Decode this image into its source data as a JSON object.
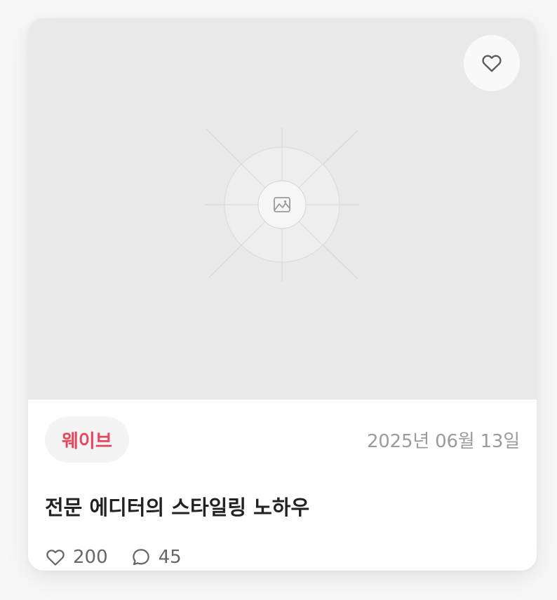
{
  "card": {
    "category": "웨이브",
    "date": "2025년 06월 13일",
    "title": "전문 에디터의 스타일링 노하우",
    "likes": "200",
    "comments": "45"
  },
  "colors": {
    "category_text": "#e5475d",
    "thumbnail_bg": "#e9e9e9"
  },
  "icons": {
    "favorite": "heart-outline-icon",
    "image_placeholder": "image-icon",
    "like_stat": "heart-outline-icon",
    "comment_stat": "speech-bubble-icon"
  }
}
